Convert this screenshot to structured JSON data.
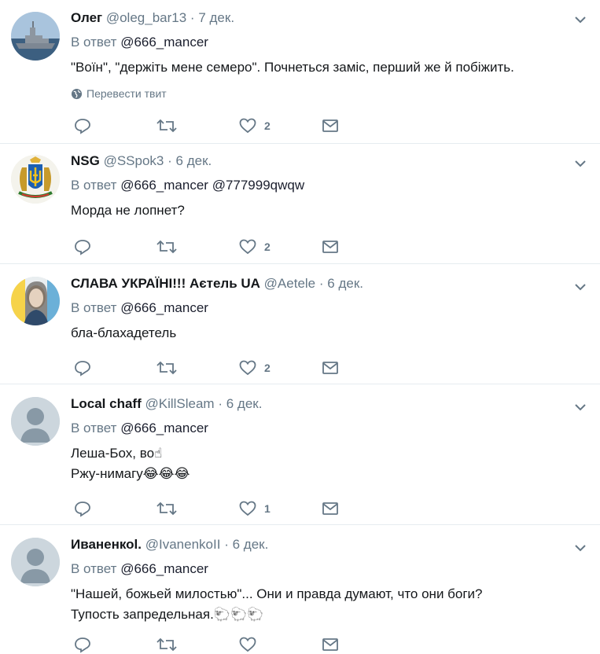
{
  "reply_prefix": "В ответ",
  "translate_label": "Перевести твит",
  "tweets": [
    {
      "name": "Олег",
      "handle": "@oleg_bar13",
      "time": "7 дек.",
      "reply_to": [
        "@666_mancer"
      ],
      "lines": [
        "\"Воїн\", \"держіть мене семеро\". Почнеться заміс, перший же й побіжить."
      ],
      "likes": "2",
      "avatar": "warship-photo"
    },
    {
      "name": "NSG",
      "handle": "@SSpok3",
      "time": "6 дек.",
      "reply_to": [
        "@666_mancer",
        "@777999qwqw"
      ],
      "lines": [
        "Морда не лопнет?"
      ],
      "likes": "2",
      "avatar": "ukraine-coat-of-arms"
    },
    {
      "name": "СЛАВА УКРАЇНІ!!! Аєтель UA",
      "handle": "@Aetele",
      "time": "6 дек.",
      "reply_to": [
        "@666_mancer"
      ],
      "lines": [
        "бла-блахадетель"
      ],
      "likes": "2",
      "avatar": "woman-portrait"
    },
    {
      "name": "Local chaff",
      "handle": "@KillSleam",
      "time": "6 дек.",
      "reply_to": [
        "@666_mancer"
      ],
      "lines": [
        "Леша-Бох, во☝",
        "Ржу-нимагу😂😂😂"
      ],
      "likes": "1",
      "avatar": "default-profile"
    },
    {
      "name": "Иваненкоl.",
      "handle": "@IvanenkoII",
      "time": "6 дек.",
      "reply_to": [
        "@666_mancer"
      ],
      "lines": [
        "\"Нашей, божьей милостью\"... Они и правда думают, что они боги?",
        "Тупость запредельная.🐑🐑🐑"
      ],
      "likes": "",
      "avatar": "default-profile"
    }
  ]
}
